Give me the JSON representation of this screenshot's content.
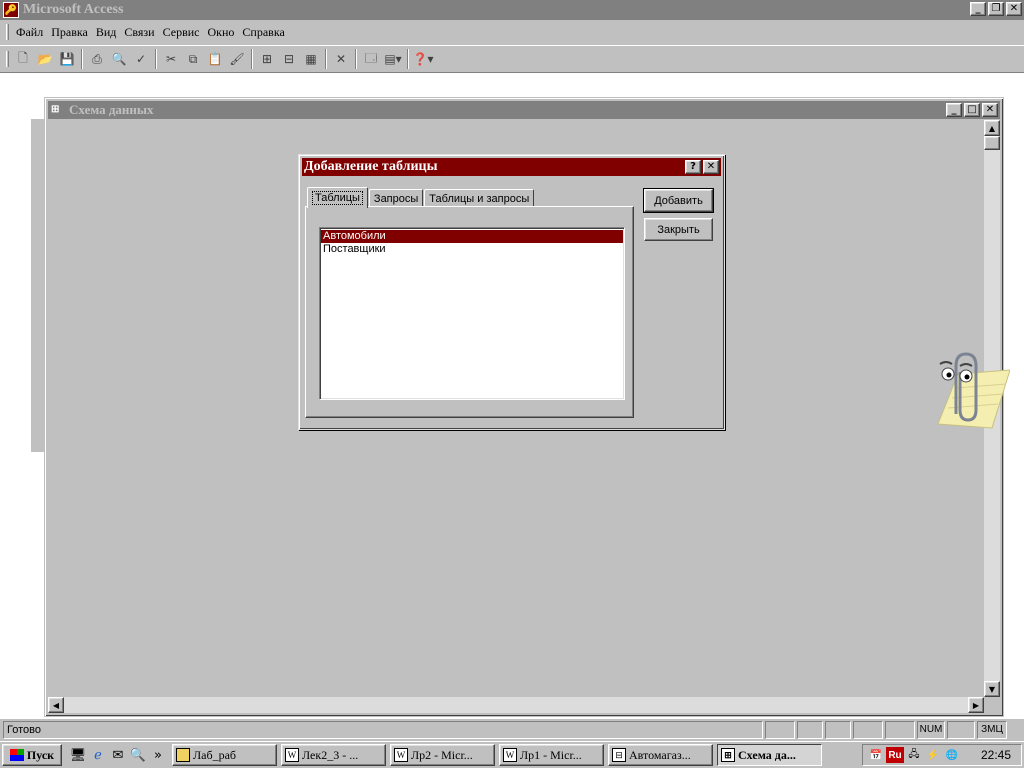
{
  "app": {
    "title": "Microsoft Access",
    "caption_buttons": [
      "_",
      "❐",
      "✕"
    ]
  },
  "menu": {
    "items": [
      "Файл",
      "Правка",
      "Вид",
      "Связи",
      "Сервис",
      "Окно",
      "Справка"
    ]
  },
  "toolbar": {
    "icons": [
      "new-icon",
      "open-icon",
      "save-icon",
      "print-icon",
      "print-preview-icon",
      "spelling-icon",
      "cut-icon",
      "copy-icon",
      "paste-icon",
      "format-painter-icon",
      "show-table-icon",
      "show-direct-icon",
      "show-all-icon",
      "delete-icon",
      "database-window-icon",
      "new-object-icon",
      "help-icon"
    ]
  },
  "child_window": {
    "title": "Схема данных"
  },
  "dialog": {
    "title": "Добавление таблицы",
    "help_btn": "?",
    "close_btn": "✕",
    "tabs": [
      "Таблицы",
      "Запросы",
      "Таблицы и запросы"
    ],
    "active_tab": 0,
    "list_items": [
      "Автомобили",
      "Поставщики"
    ],
    "selected_index": 0,
    "add_button": "Добавить",
    "close_button": "Закрыть"
  },
  "statusbar": {
    "status": "Готово",
    "num": "NUM",
    "caps": "ЗМЦ"
  },
  "taskbar": {
    "start": "Пуск",
    "more": "»",
    "tasks": [
      "Лаб_раб",
      "Лек2_3 - ...",
      "Лр2 - Micr...",
      "Лр1 - Micr...",
      "Автомагаз...",
      "Схема да..."
    ],
    "active_task": 5,
    "tray_lang": "Ru",
    "clock": "22:45"
  },
  "colors": {
    "dialog_title": "#800000",
    "selection": "#800000",
    "inactive_title": "#808080",
    "face": "#c0c0c0"
  }
}
